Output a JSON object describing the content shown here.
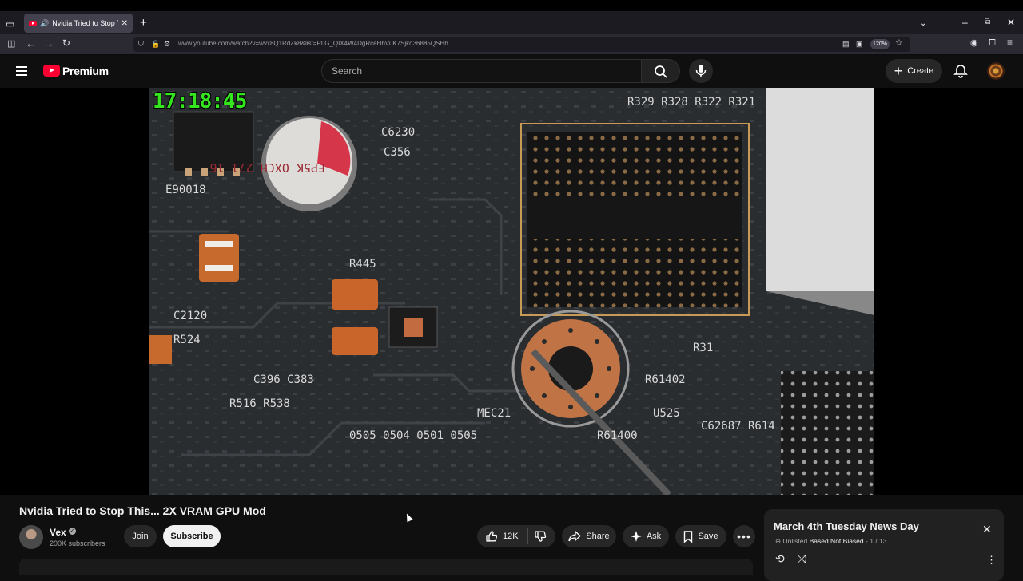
{
  "browser": {
    "tab_title": "Nvidia Tried to Stop This... 2X",
    "url": "www.youtube.com/watch?v=wvx8Q1RdZk8&list=PLG_QIX4W4DgRceHbVuK7Sjkq36885QSHb",
    "zoom": "120%"
  },
  "youtube": {
    "brand": "Premium",
    "search_placeholder": "Search",
    "create_label": "Create"
  },
  "video": {
    "overlay_time": "17:18:45",
    "title": "Nvidia Tried to Stop This... 2X VRAM GPU Mod"
  },
  "channel": {
    "name": "Vex",
    "subscribers": "200K subscribers",
    "join_label": "Join",
    "subscribe_label": "Subscribe"
  },
  "actions": {
    "likes": "12K",
    "share_label": "Share",
    "ask_label": "Ask",
    "save_label": "Save"
  },
  "playlist": {
    "title": "March 4th Tuesday News Day",
    "visibility": "Unlisted",
    "owner": "Based Not Biased",
    "position": "1 / 13"
  },
  "colors": {
    "youtube_red": "#ff0033",
    "timestamp_green": "#35e61e",
    "background": "#0f0f0f"
  }
}
